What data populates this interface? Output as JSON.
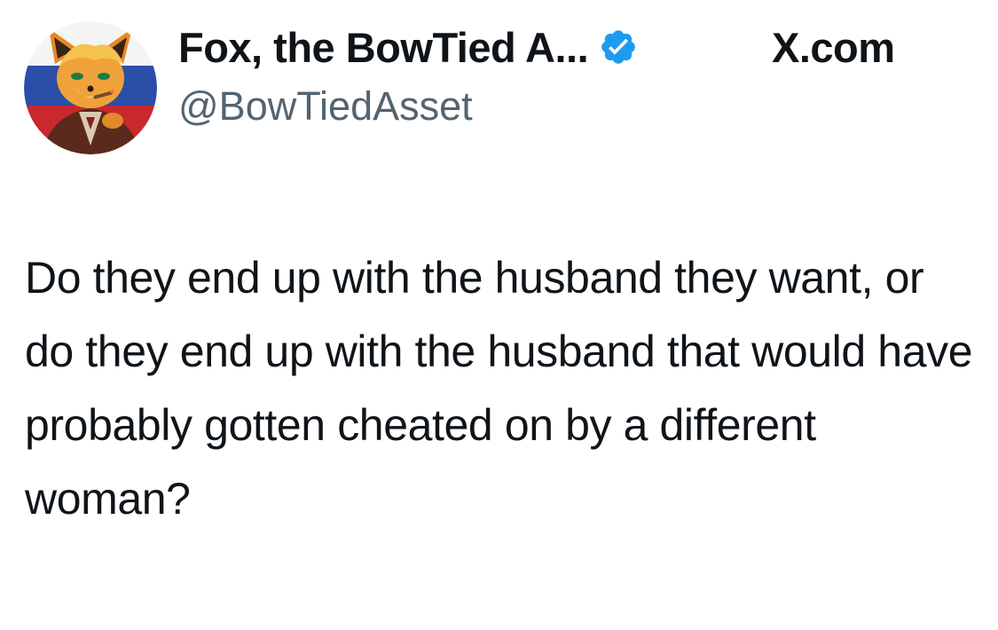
{
  "tweet": {
    "author": {
      "display_name": "Fox, the BowTied A...",
      "handle": "@BowTiedAsset",
      "verified": true,
      "avatar_icon": "fox-avatar-icon"
    },
    "site_label": "X.com",
    "text": "Do they end up with the husband they want, or do they end up with the husband that would have probably gotten cheated on by a different woman?"
  },
  "colors": {
    "verified_badge": "#1d9bf0",
    "text": "#0f1419",
    "secondary_text": "#536471",
    "background": "#ffffff"
  }
}
